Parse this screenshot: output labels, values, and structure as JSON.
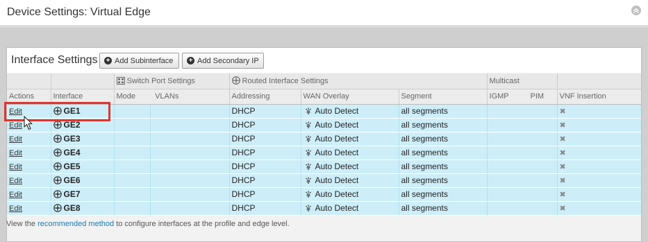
{
  "window": {
    "title": "Device Settings: Virtual Edge"
  },
  "panel": {
    "title": "Interface Settings",
    "buttons": {
      "add_subinterface": "Add Subinterface",
      "add_secondary_ip": "Add Secondary IP"
    }
  },
  "groups": {
    "switch_port": "Switch Port Settings",
    "routed": "Routed Interface Settings",
    "multicast": "Multicast"
  },
  "columns": {
    "actions": "Actions",
    "interface": "Interface",
    "mode": "Mode",
    "vlans": "VLANs",
    "addressing": "Addressing",
    "wan_overlay": "WAN Overlay",
    "segment": "Segment",
    "igmp": "IGMP",
    "pim": "PIM",
    "vnf": "VNF Insertion"
  },
  "rows": [
    {
      "action": "Edit",
      "interface": "GE1",
      "addressing": "DHCP",
      "wan_overlay": "Auto Detect",
      "segment": "all segments",
      "vnf": "✖"
    },
    {
      "action": "Edit",
      "interface": "GE2",
      "addressing": "DHCP",
      "wan_overlay": "Auto Detect",
      "segment": "all segments",
      "vnf": "✖"
    },
    {
      "action": "Edit",
      "interface": "GE3",
      "addressing": "DHCP",
      "wan_overlay": "Auto Detect",
      "segment": "all segments",
      "vnf": "✖"
    },
    {
      "action": "Edit",
      "interface": "GE4",
      "addressing": "DHCP",
      "wan_overlay": "Auto Detect",
      "segment": "all segments",
      "vnf": "✖"
    },
    {
      "action": "Edit",
      "interface": "GE5",
      "addressing": "DHCP",
      "wan_overlay": "Auto Detect",
      "segment": "all segments",
      "vnf": "✖"
    },
    {
      "action": "Edit",
      "interface": "GE6",
      "addressing": "DHCP",
      "wan_overlay": "Auto Detect",
      "segment": "all segments",
      "vnf": "✖"
    },
    {
      "action": "Edit",
      "interface": "GE7",
      "addressing": "DHCP",
      "wan_overlay": "Auto Detect",
      "segment": "all segments",
      "vnf": "✖"
    },
    {
      "action": "Edit",
      "interface": "GE8",
      "addressing": "DHCP",
      "wan_overlay": "Auto Detect",
      "segment": "all segments",
      "vnf": "✖"
    }
  ],
  "footer": {
    "prefix": "View the ",
    "link": "recommended method",
    "suffix": " to configure interfaces at the profile and edge level."
  },
  "icons": {
    "collapse": "chevron-up-icon",
    "add": "plus-circle-icon",
    "switch": "switch-icon",
    "routed": "router-icon",
    "interface": "interface-port-icon",
    "wan": "auto-detect-icon",
    "remove": "close-icon"
  },
  "colors": {
    "row_bg": "#cdeef9",
    "highlight": "#e0342f",
    "link": "#1a7bb4"
  }
}
